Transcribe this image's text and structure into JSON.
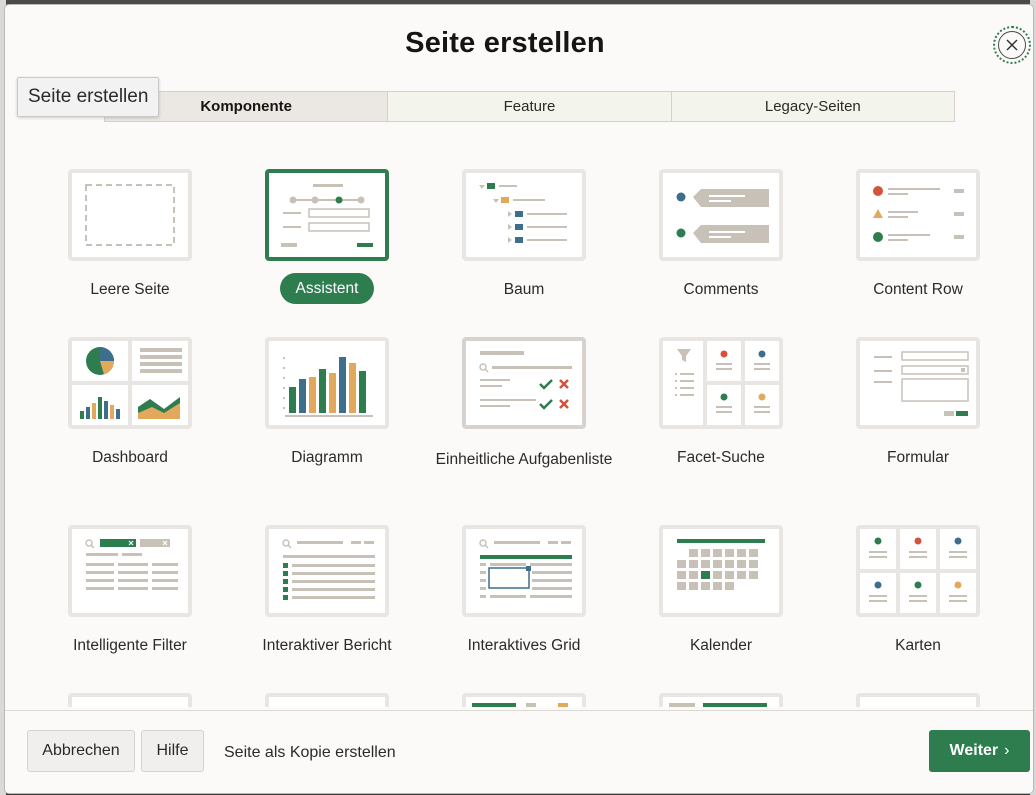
{
  "dialog": {
    "title": "Seite erstellen",
    "tooltip": "Seite erstellen"
  },
  "tabs": [
    {
      "label": "Komponente",
      "active": true
    },
    {
      "label": "Feature",
      "active": false
    },
    {
      "label": "Legacy-Seiten",
      "active": false
    }
  ],
  "tiles": [
    {
      "label": "Leere Seite",
      "icon": "blank-page-icon"
    },
    {
      "label": "Assistent",
      "icon": "wizard-icon",
      "selected": true
    },
    {
      "label": "Baum",
      "icon": "tree-icon"
    },
    {
      "label": "Comments",
      "icon": "comments-icon"
    },
    {
      "label": "Content Row",
      "icon": "content-row-icon"
    },
    {
      "label": "Dashboard",
      "icon": "dashboard-icon"
    },
    {
      "label": "Diagramm",
      "icon": "chart-icon"
    },
    {
      "label": "Einheitliche Aufgabenliste",
      "icon": "task-list-icon"
    },
    {
      "label": "Facet-Suche",
      "icon": "facet-search-icon"
    },
    {
      "label": "Formular",
      "icon": "form-icon"
    },
    {
      "label": "Intelligente Filter",
      "icon": "smart-filter-icon"
    },
    {
      "label": "Interaktiver Bericht",
      "icon": "interactive-report-icon"
    },
    {
      "label": "Interaktives Grid",
      "icon": "interactive-grid-icon"
    },
    {
      "label": "Kalender",
      "icon": "calendar-icon"
    },
    {
      "label": "Karten",
      "icon": "cards-icon"
    }
  ],
  "footer": {
    "cancel": "Abbrechen",
    "help": "Hilfe",
    "copy": "Seite als Kopie erstellen",
    "next": "Weiter"
  },
  "colors": {
    "accent": "#2e7d4f",
    "blue": "#3d6e8c",
    "orange": "#e2a85c",
    "red": "#d4533c",
    "gray": "#c8c1b8"
  }
}
